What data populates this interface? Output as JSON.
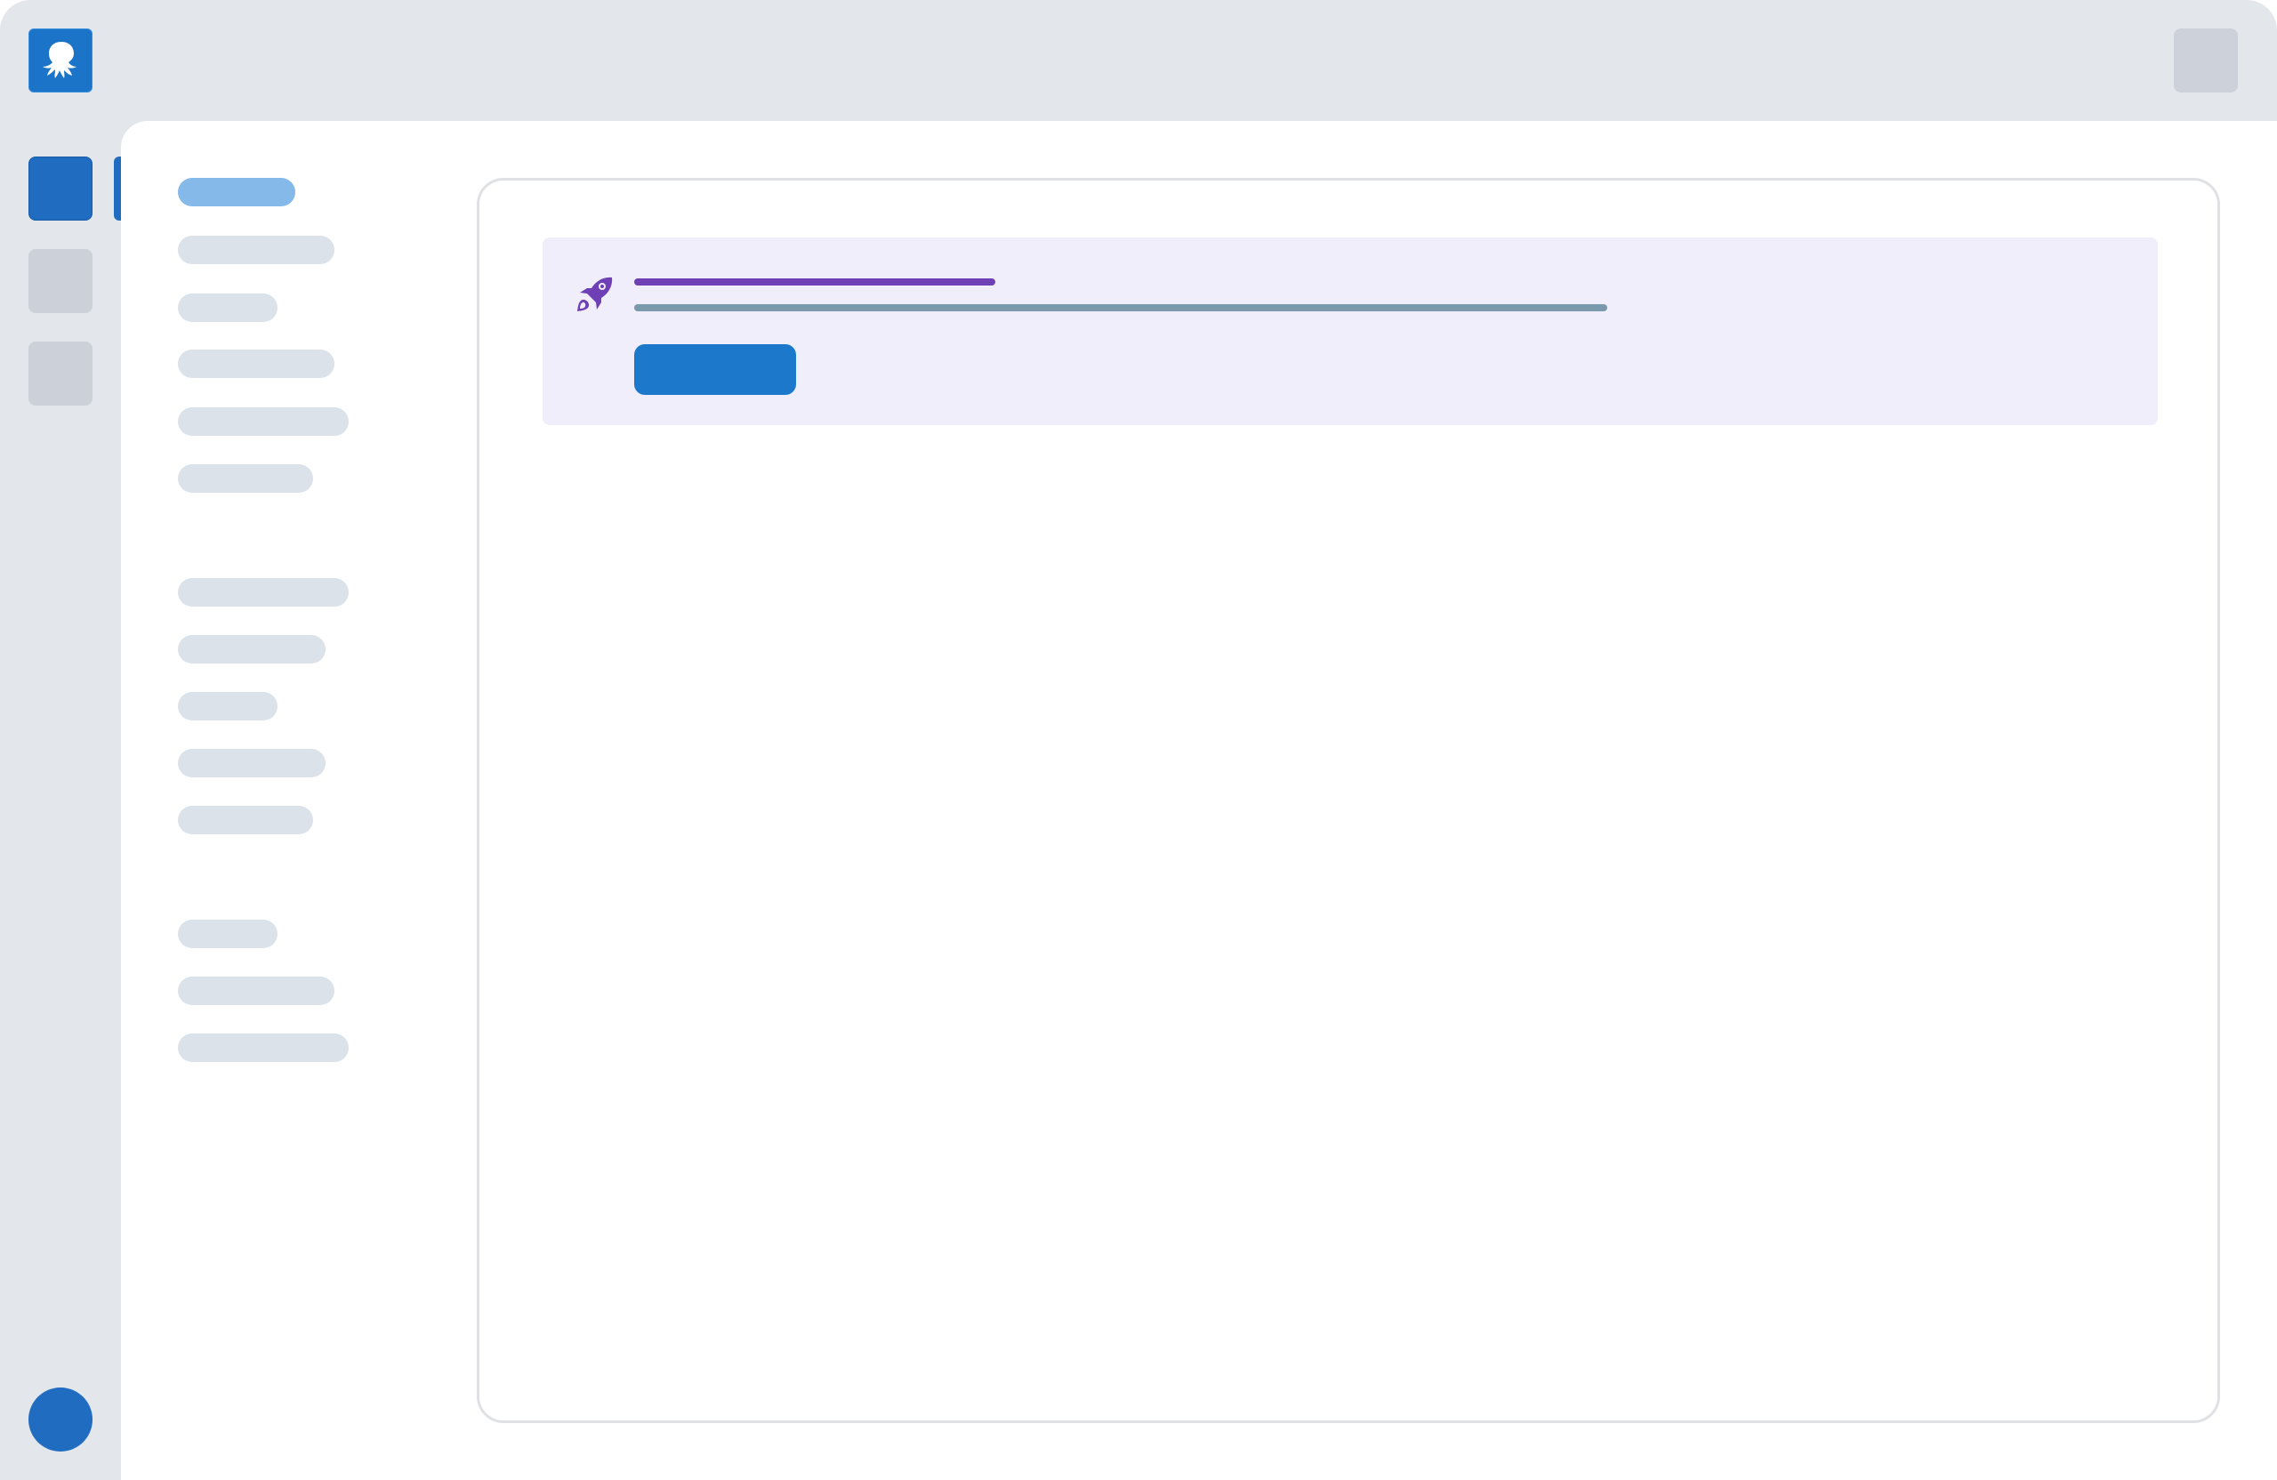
{
  "app": {
    "logo_icon": "octopus-icon",
    "colors": {
      "brand_blue": "#1b74c8",
      "active_nav": "#85b9e9",
      "banner_bg": "#f1eefb",
      "banner_accent": "#6e3fb5"
    }
  },
  "topbar": {
    "right_button_icon": "placeholder-square"
  },
  "rail": {
    "items": [
      {
        "icon": "placeholder-square",
        "active": true
      },
      {
        "icon": "placeholder-square",
        "active": false
      },
      {
        "icon": "placeholder-square",
        "active": false
      }
    ],
    "avatar_icon": "user-avatar"
  },
  "sidebar": {
    "groups": [
      {
        "items": [
          {
            "label": "",
            "active": true
          },
          {
            "label": ""
          },
          {
            "label": ""
          },
          {
            "label": ""
          },
          {
            "label": ""
          },
          {
            "label": ""
          }
        ]
      },
      {
        "items": [
          {
            "label": ""
          },
          {
            "label": ""
          },
          {
            "label": ""
          },
          {
            "label": ""
          },
          {
            "label": ""
          }
        ]
      },
      {
        "items": [
          {
            "label": ""
          },
          {
            "label": ""
          },
          {
            "label": ""
          }
        ]
      }
    ]
  },
  "banner": {
    "icon": "rocket-icon",
    "title": "",
    "description": "",
    "button_label": ""
  }
}
